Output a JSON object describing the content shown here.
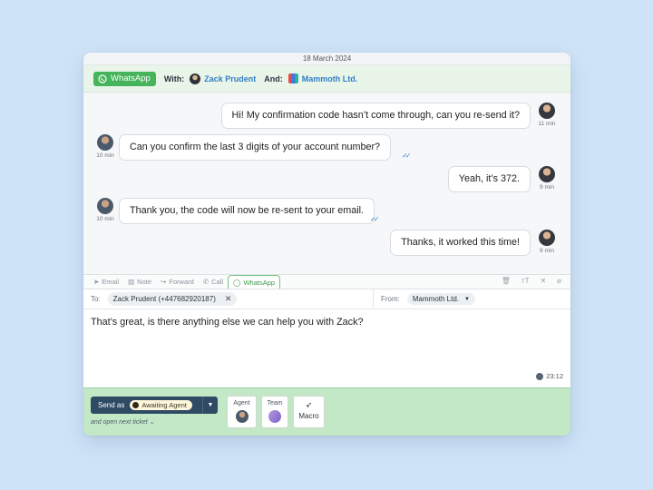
{
  "date": "18 March 2024",
  "header": {
    "channel": "WhatsApp",
    "with_label": "With:",
    "contact": "Zack Prudent",
    "and_label": "And:",
    "company": "Mammoth Ltd."
  },
  "messages": [
    {
      "from": "customer",
      "text": "Hi! My confirmation code hasn’t come through, can you re-send it?",
      "time": "11 min"
    },
    {
      "from": "agent",
      "text": "Can you confirm the last 3 digits of your account number?",
      "time": "10 min"
    },
    {
      "from": "customer",
      "text": "Yeah, it’s 372.",
      "time": "9 min"
    },
    {
      "from": "agent",
      "text": "Thank you, the code will now be re-sent to your email.",
      "time": "10 min"
    },
    {
      "from": "customer",
      "text": "Thanks, it worked this time!",
      "time": "9 min"
    }
  ],
  "toolbar": {
    "tabs": [
      "Email",
      "Note",
      "Forward",
      "Call",
      "WhatsApp"
    ],
    "active_tab": "WhatsApp"
  },
  "address": {
    "to_label": "To:",
    "to_value": "Zack Prudent  (+447682920187)",
    "from_label": "From:",
    "from_value": "Mammoth Ltd."
  },
  "compose": {
    "text": "That’s great, is there anything else we can help you with Zack?",
    "timer": "23:12"
  },
  "footer": {
    "send_label": "Send as",
    "status": "Awaiting Agent",
    "next_ticket": "and open next ticket",
    "agent_label": "Agent",
    "team_label": "Team",
    "macro_label": "Macro"
  },
  "colors": {
    "whatsapp_green": "#45b45a",
    "link_blue": "#2f7fc4",
    "footer_green": "#c3e8c6",
    "send_button": "#2f4a63"
  }
}
